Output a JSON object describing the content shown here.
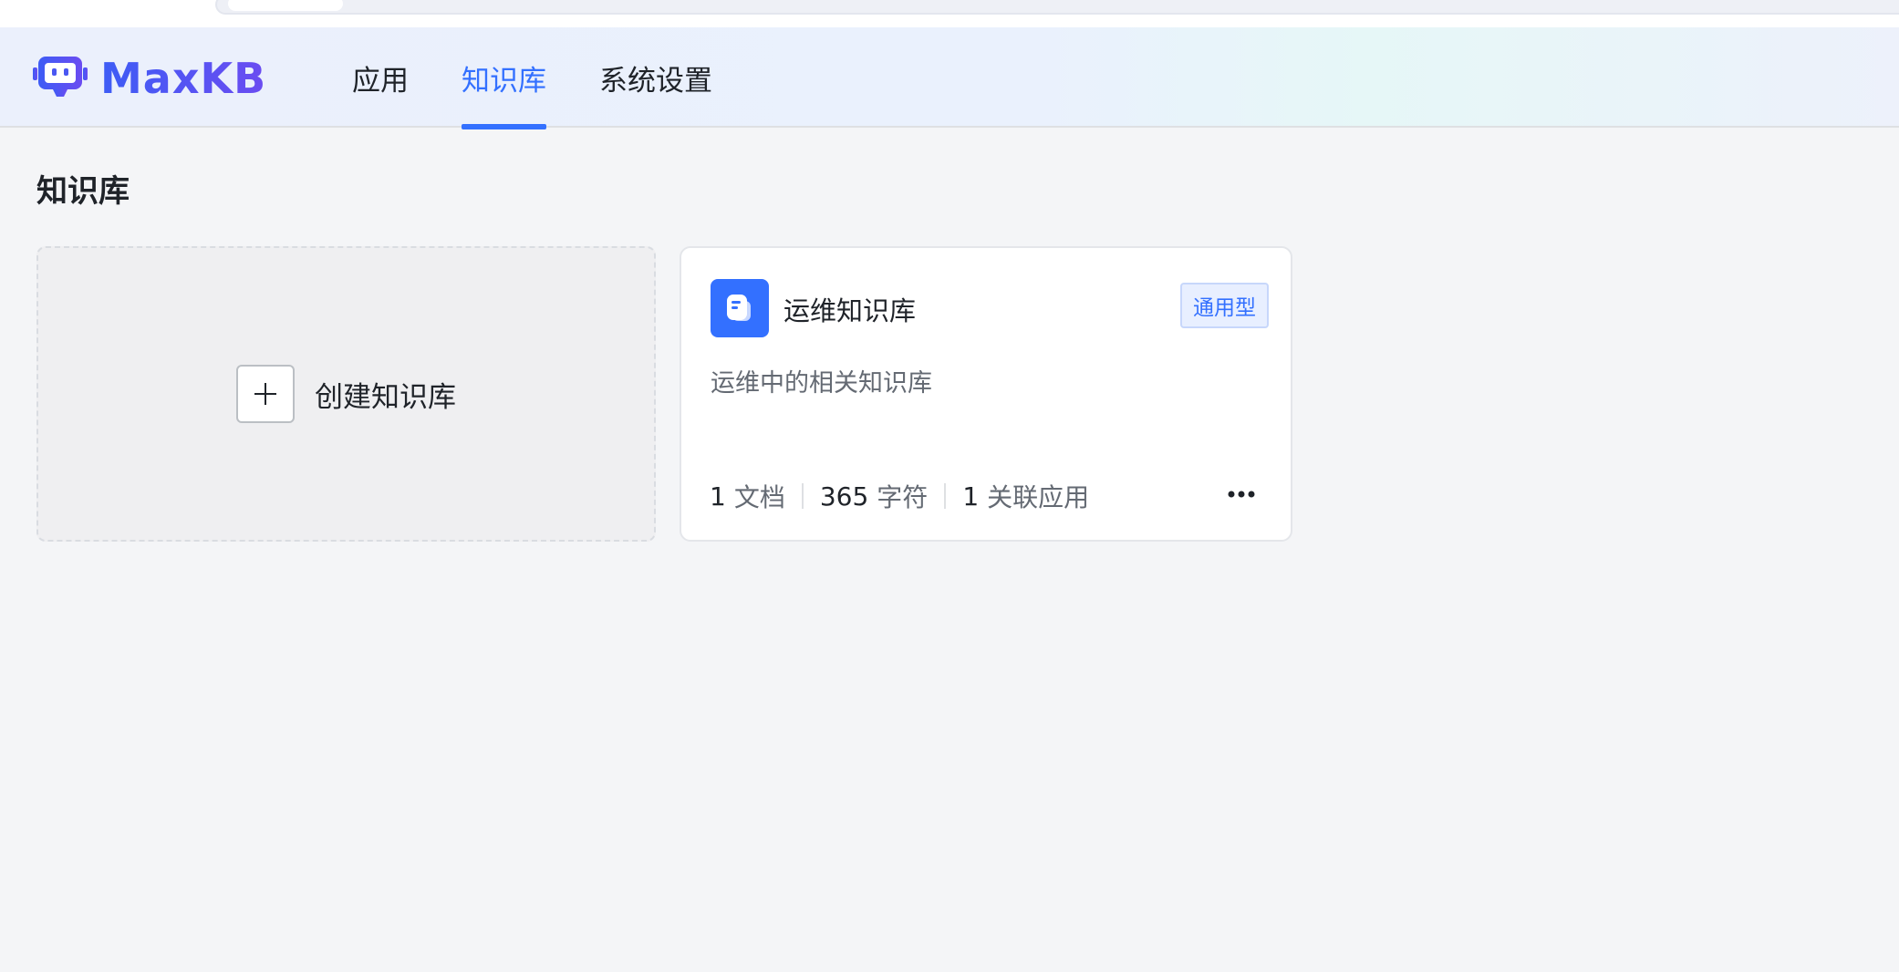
{
  "header": {
    "logo_text": "MaxKB",
    "nav": [
      {
        "label": "应用",
        "active": false
      },
      {
        "label": "知识库",
        "active": true
      },
      {
        "label": "系统设置",
        "active": false
      }
    ]
  },
  "page": {
    "title": "知识库"
  },
  "create_card": {
    "label": "创建知识库",
    "icon": "plus-icon"
  },
  "knowledge_bases": [
    {
      "name": "运维知识库",
      "tag": "通用型",
      "description": "运维中的相关知识库",
      "icon": "document-icon",
      "stats": {
        "docs_count": "1",
        "docs_label": "文档",
        "chars_count": "365",
        "chars_label": "字符",
        "apps_count": "1",
        "apps_label": "关联应用"
      },
      "more_icon": "more-horizontal-icon"
    }
  ],
  "colors": {
    "primary": "#3370ff",
    "logo_gradient_start": "#3d5cf5",
    "logo_gradient_end": "#6b4cf1",
    "tag_bg": "#e8efff"
  }
}
